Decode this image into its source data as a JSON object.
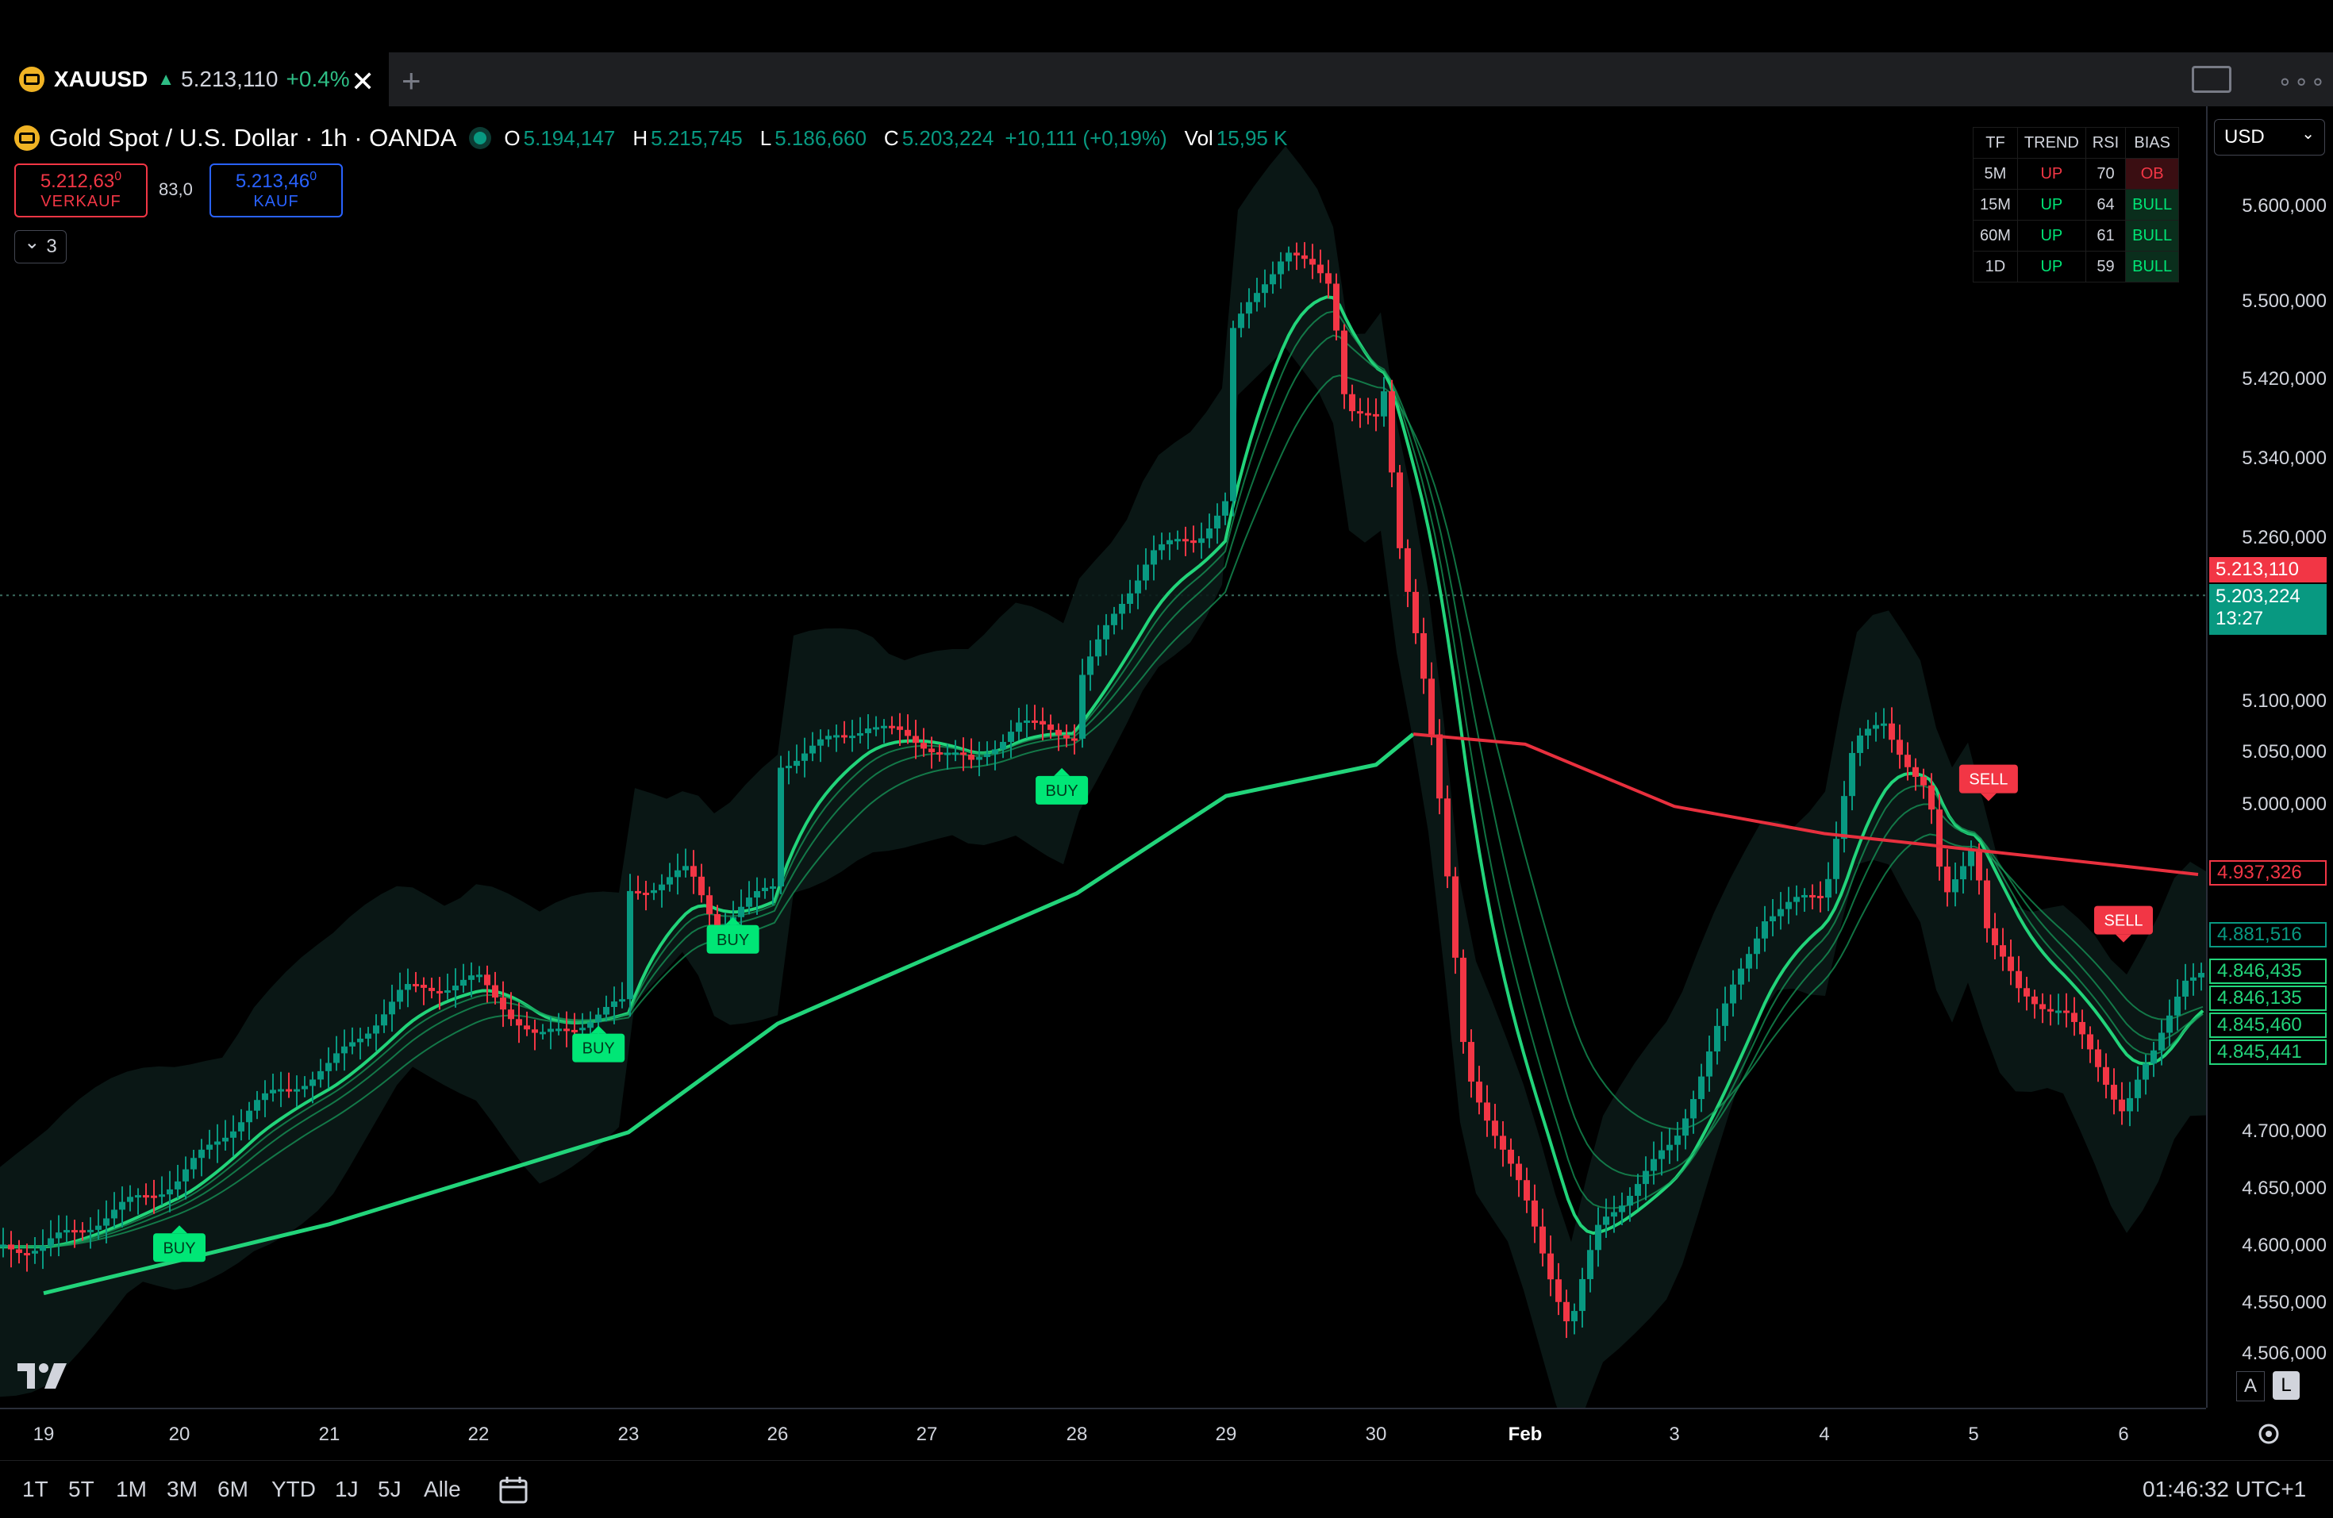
{
  "tab": {
    "symbol": "XAUUSD",
    "arrow": "▲",
    "price": "5.213,110",
    "change": "+0.4%",
    "close": "✕",
    "add": "+"
  },
  "header": {
    "title": "Gold Spot / U.S. Dollar · 1h · OANDA",
    "o_label": "O",
    "o": "5.194,147",
    "h_label": "H",
    "h": "5.215,745",
    "l_label": "L",
    "l": "5.186,660",
    "c_label": "C",
    "c": "5.203,224",
    "change": "+10,111 (+0,19%)",
    "vol_label": "Vol",
    "vol": "15,95 K"
  },
  "trade": {
    "sell_price": "5.212,63",
    "sell_sup": "0",
    "sell_label": "VERKAUF",
    "spread": "83,0",
    "buy_price": "5.213,46",
    "buy_sup": "0",
    "buy_label": "KAUF"
  },
  "indicators_toggle": {
    "chevron": "⌄",
    "count": "3"
  },
  "table": {
    "headers": [
      "TF",
      "TREND",
      "RSI",
      "BIAS"
    ],
    "rows": [
      {
        "tf": "5M",
        "trend": "UP",
        "rsi": "70",
        "bias": "OB"
      },
      {
        "tf": "15M",
        "trend": "UP",
        "rsi": "64",
        "bias": "BULL"
      },
      {
        "tf": "60M",
        "trend": "UP",
        "rsi": "61",
        "bias": "BULL"
      },
      {
        "tf": "1D",
        "trend": "UP",
        "rsi": "59",
        "bias": "BULL"
      }
    ]
  },
  "currency": {
    "value": "USD",
    "chevron": "⌄"
  },
  "price_axis": {
    "labels": [
      "5.600,000",
      "5.500,000",
      "5.420,000",
      "5.340,000",
      "5.260,000",
      "5.100,000",
      "5.050,000",
      "5.000,000",
      "4.700,000",
      "4.650,000",
      "4.600,000",
      "4.550,000",
      "4.506,000"
    ],
    "tags": {
      "last": "5.213,110",
      "close": "5.203,224",
      "countdown": "13:27",
      "ema_red": "4.937,326",
      "teal": "4.881,516",
      "green1": "4.846,435",
      "green2": "4.846,135",
      "green3": "4.845,460",
      "green4": "4.845,441"
    },
    "badge_a": "A",
    "badge_l": "L"
  },
  "time_axis": [
    "19",
    "20",
    "21",
    "22",
    "23",
    "26",
    "27",
    "28",
    "29",
    "30",
    "Feb",
    "3",
    "4",
    "5",
    "6"
  ],
  "ranges": [
    "1T",
    "5T",
    "1M",
    "3M",
    "6M",
    "YTD",
    "1J",
    "5J",
    "Alle"
  ],
  "clock": "01:46:32 UTC+1",
  "signals": {
    "buy": "BUY",
    "sell": "SELL"
  },
  "colors": {
    "up": "#089981",
    "down": "#f23645",
    "ema_green": "#22d47a",
    "ema_red": "#e8303e",
    "buy_label": "#00e676",
    "sell_label": "#f23645"
  },
  "chart_data": {
    "type": "candlestick",
    "timeframe": "1h",
    "symbol": "XAUUSD",
    "x_labels": [
      "19",
      "20",
      "21",
      "22",
      "23",
      "26",
      "27",
      "28",
      "29",
      "30",
      "Feb",
      "3",
      "4",
      "5",
      "6"
    ],
    "ylim": [
      4480,
      5680
    ],
    "close_path": [
      {
        "x": "19",
        "y": 4600
      },
      {
        "x": "20",
        "y": 4660
      },
      {
        "x": "20.5",
        "y": 4725
      },
      {
        "x": "21",
        "y": 4760
      },
      {
        "x": "21.5",
        "y": 4830
      },
      {
        "x": "22",
        "y": 4840
      },
      {
        "x": "22.4",
        "y": 4785
      },
      {
        "x": "23",
        "y": 4820
      },
      {
        "x": "23",
        "y": 4920
      },
      {
        "x": "23.4",
        "y": 4940
      },
      {
        "x": "23.6",
        "y": 4890
      },
      {
        "x": "26",
        "y": 4930
      },
      {
        "x": "26",
        "y": 5040
      },
      {
        "x": "26.6",
        "y": 5080
      },
      {
        "x": "27",
        "y": 5060
      },
      {
        "x": "27.3",
        "y": 5040
      },
      {
        "x": "27.6",
        "y": 5080
      },
      {
        "x": "28",
        "y": 5070
      },
      {
        "x": "28",
        "y": 5120
      },
      {
        "x": "28.5",
        "y": 5250
      },
      {
        "x": "28.8",
        "y": 5260
      },
      {
        "x": "29",
        "y": 5300
      },
      {
        "x": "29",
        "y": 5460
      },
      {
        "x": "29.4",
        "y": 5560
      },
      {
        "x": "29.7",
        "y": 5520
      },
      {
        "x": "29.8",
        "y": 5400
      },
      {
        "x": "30",
        "y": 5380
      },
      {
        "x": "30.1",
        "y": 5410
      },
      {
        "x": "30.3",
        "y": 5260
      },
      {
        "x": "30.6",
        "y": 5150
      },
      {
        "x": "30.8",
        "y": 5040
      },
      {
        "x": "31",
        "y": 4900
      },
      {
        "x": "31.2",
        "y": 4760
      },
      {
        "x": "Feb",
        "y": 4640
      },
      {
        "x": "Feb.3",
        "y": 4530
      },
      {
        "x": "Feb.5",
        "y": 4620
      },
      {
        "x": "Feb.7",
        "y": 4650
      },
      {
        "x": "3",
        "y": 4690
      },
      {
        "x": "3.3",
        "y": 4800
      },
      {
        "x": "3.6",
        "y": 4900
      },
      {
        "x": "4",
        "y": 4920
      },
      {
        "x": "4.2",
        "y": 5060
      },
      {
        "x": "4.4",
        "y": 5080
      },
      {
        "x": "4.7",
        "y": 5010
      },
      {
        "x": "4.8",
        "y": 4910
      },
      {
        "x": "5",
        "y": 4970
      },
      {
        "x": "5.1",
        "y": 4880
      },
      {
        "x": "5.3",
        "y": 4830
      },
      {
        "x": "5.6",
        "y": 4810
      },
      {
        "x": "5.8",
        "y": 4770
      },
      {
        "x": "6",
        "y": 4720
      },
      {
        "x": "6.2",
        "y": 4770
      },
      {
        "x": "6.4",
        "y": 4845
      }
    ],
    "ema_long": [
      {
        "x": "19",
        "y": 4560
      },
      {
        "x": "21",
        "y": 4620
      },
      {
        "x": "23",
        "y": 4700
      },
      {
        "x": "26",
        "y": 4800
      },
      {
        "x": "27",
        "y": 4860
      },
      {
        "x": "28",
        "y": 4920
      },
      {
        "x": "29",
        "y": 5010
      },
      {
        "x": "30",
        "y": 5040
      },
      {
        "x": "30.5",
        "y": 5070
      },
      {
        "x": "Feb",
        "y": 5060
      },
      {
        "x": "3",
        "y": 5000
      },
      {
        "x": "4",
        "y": 4975
      },
      {
        "x": "5",
        "y": 4960
      },
      {
        "x": "6",
        "y": 4945
      },
      {
        "x": "6.5",
        "y": 4937.326
      }
    ],
    "signals": [
      {
        "type": "BUY",
        "x": "20",
        "price": 4640
      },
      {
        "x": "22.8",
        "type": "BUY",
        "price": 4820
      },
      {
        "x": "23.7",
        "type": "BUY",
        "price": 4920
      },
      {
        "x": "27.9",
        "type": "BUY",
        "price": 5060
      },
      {
        "x": "5.1",
        "type": "SELL",
        "price": 4980
      },
      {
        "x": "6",
        "type": "SELL",
        "price": 4850
      }
    ]
  }
}
